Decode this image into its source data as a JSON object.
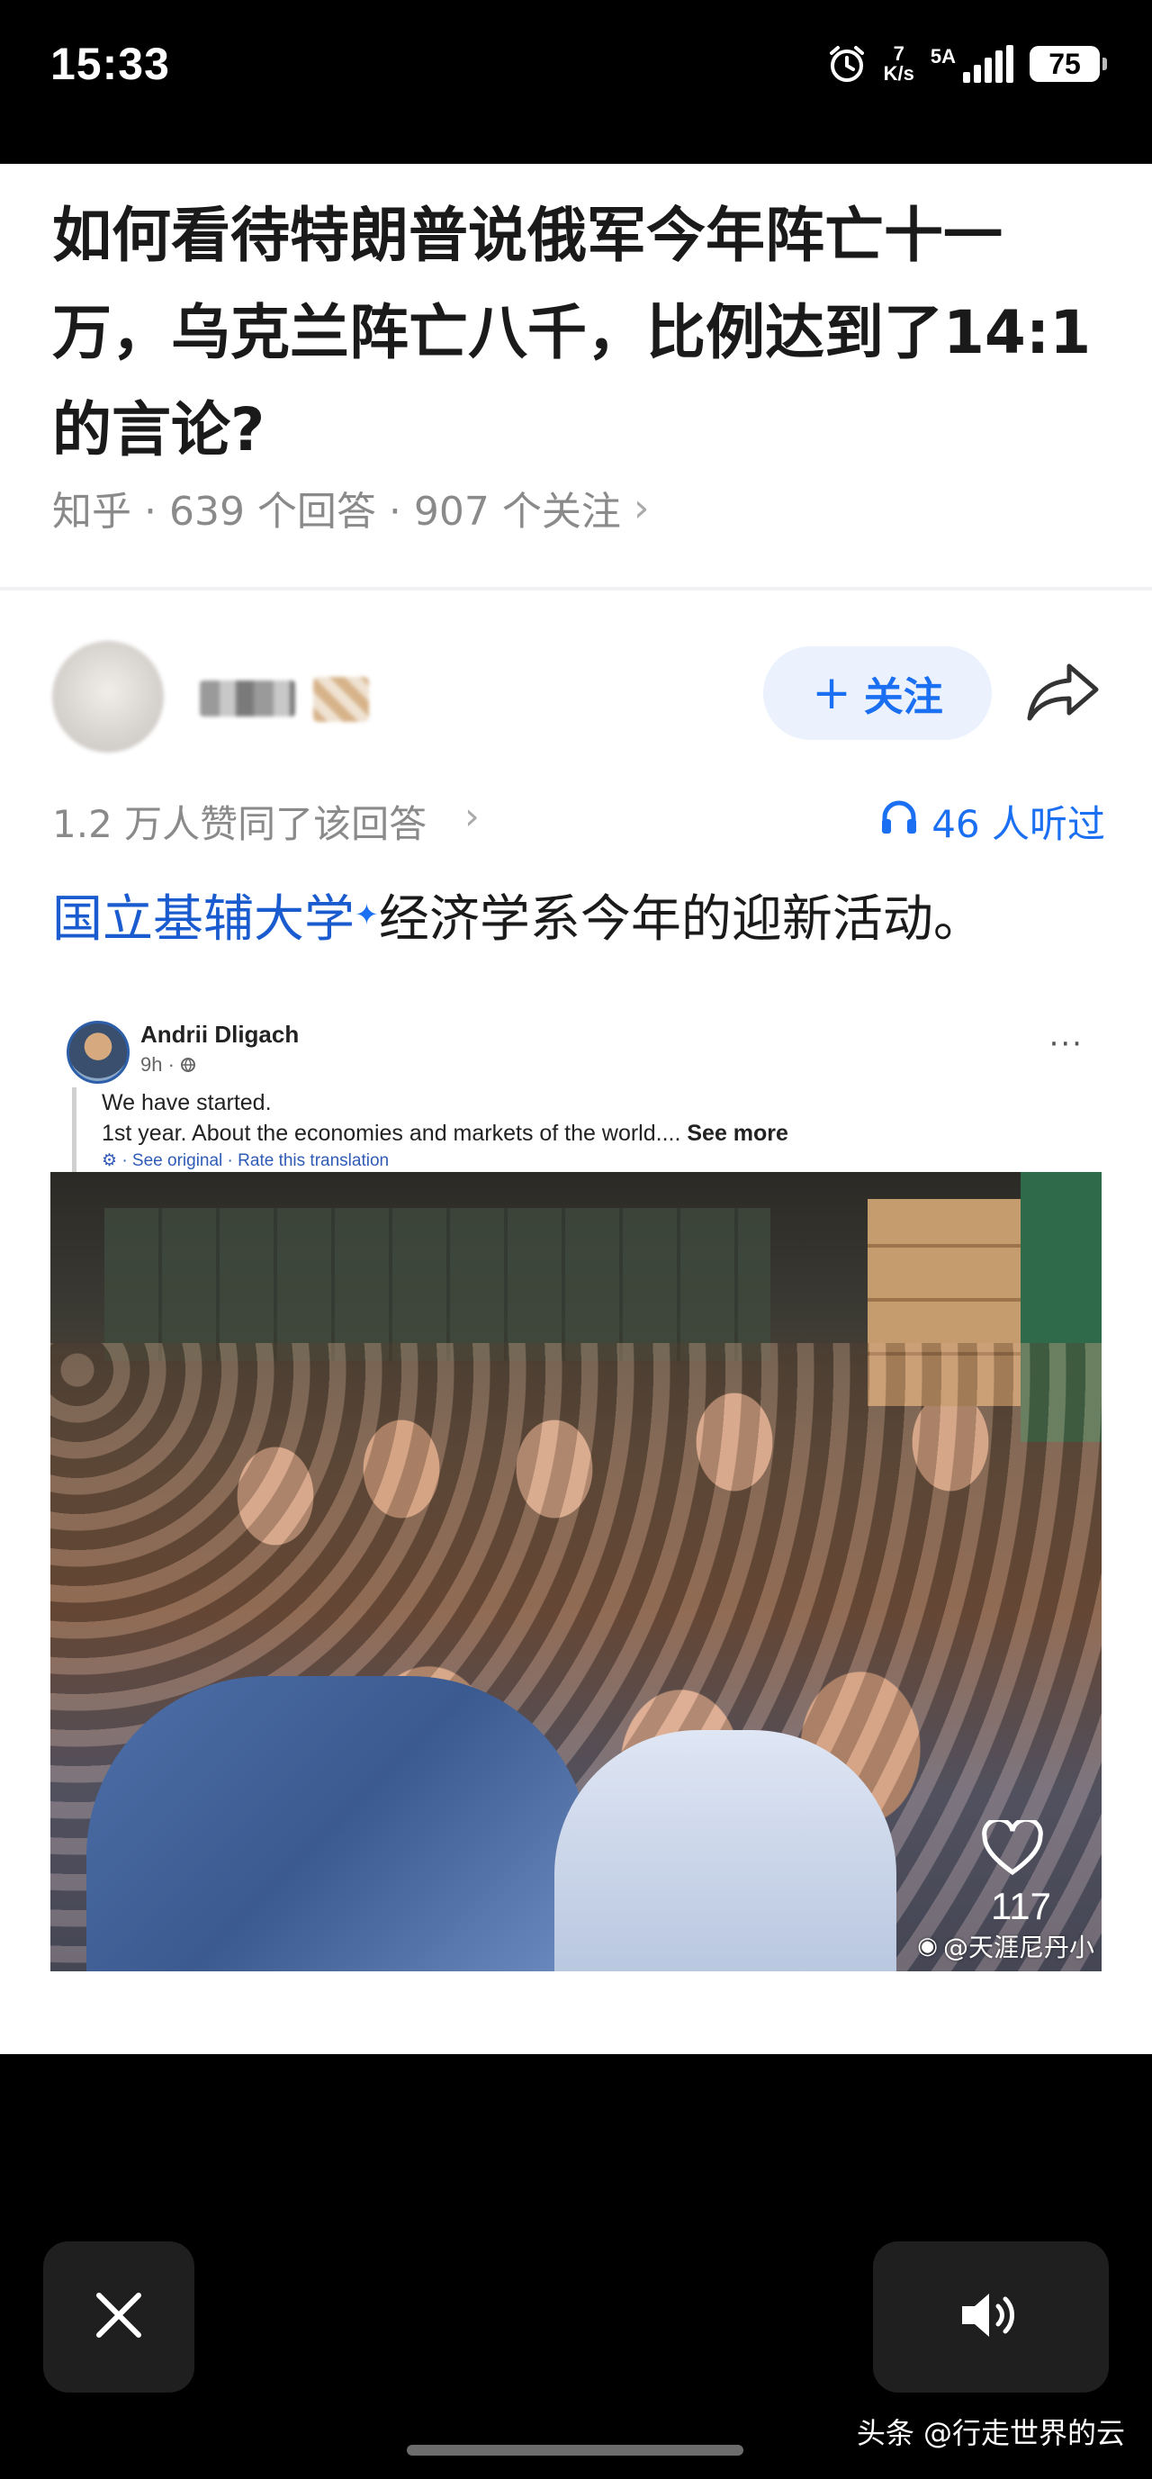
{
  "status_bar": {
    "time": "15:33",
    "net_speed_value": "7",
    "net_speed_unit": "K/s",
    "signal_label": "5A",
    "battery": "75"
  },
  "question": {
    "title": "如何看待特朗普说俄军今年阵亡十一万，乌克兰阵亡八千，比例达到了14:1的言论?",
    "meta": "知乎 · 639 个回答 · 907 个关注",
    "meta_chevron": "›"
  },
  "answer": {
    "follow_label": "关注",
    "follow_plus": "+",
    "upvote_text": "1.2 万人赞同了该回答",
    "upvote_chevron": "›",
    "listen_text": "46 人听过",
    "link_text": "国立基辅大学",
    "body_text": "经济学系今年的迎新活动。"
  },
  "facebook_post": {
    "author": "Andrii Dligach",
    "time": "9h · ",
    "line1": "We have started.",
    "line2": "1st year. About the economies and markets of the world.... ",
    "see_more": "See more",
    "translate_links": "· See original · Rate this translation",
    "more": "···",
    "like_count": "117",
    "weibo_watermark": "@天涯尼丹小"
  },
  "bottom_bar": {
    "toutiao_watermark": "头条 @行走世界的云"
  },
  "colors": {
    "accent_blue": "#1a6ff2",
    "link_blue": "#1a5ccf",
    "follow_bg": "#ebf2fd",
    "meta_gray": "#8a8a8a"
  },
  "icons": [
    "alarm-icon",
    "battery-icon",
    "signal-icon",
    "share-icon",
    "headphones-icon",
    "sparkle-icon",
    "globe-icon",
    "heart-icon",
    "weibo-icon",
    "close-icon",
    "speaker-icon"
  ]
}
